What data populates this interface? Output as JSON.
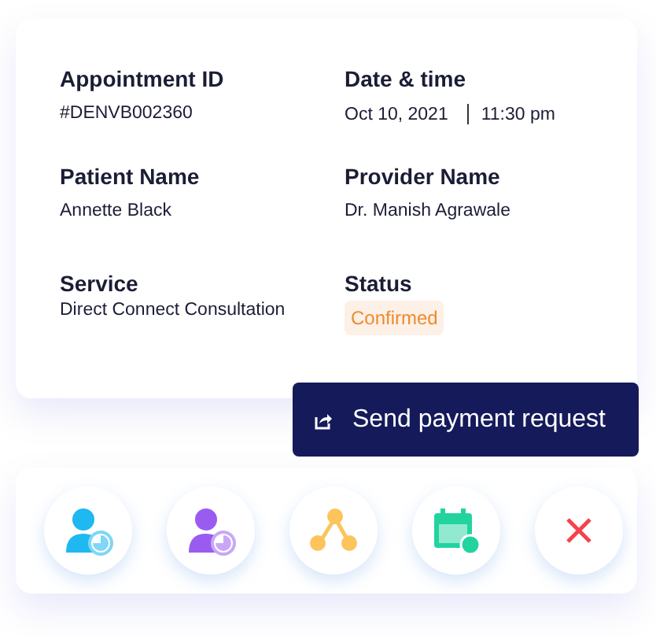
{
  "details": [
    {
      "label": "Appointment ID",
      "kind": "text",
      "value": "#DENVB002360"
    },
    {
      "label": "Date & time",
      "kind": "datetime",
      "date": "Oct 10, 2021",
      "time": "11:30 pm"
    },
    {
      "label": "Patient Name",
      "kind": "text",
      "value": "Annette Black"
    },
    {
      "label": "Provider Name",
      "kind": "text",
      "value": "Dr. Manish Agrawale"
    },
    {
      "label": "Service",
      "kind": "text",
      "value": "Direct Connect Consultation"
    },
    {
      "label": "Status",
      "kind": "status",
      "value": "Confirmed"
    }
  ],
  "tooltip": {
    "label": "Send payment request"
  },
  "actions": [
    {
      "kind": "patient"
    },
    {
      "kind": "doctor"
    },
    {
      "kind": "share"
    },
    {
      "kind": "calendar"
    },
    {
      "kind": "close"
    }
  ]
}
